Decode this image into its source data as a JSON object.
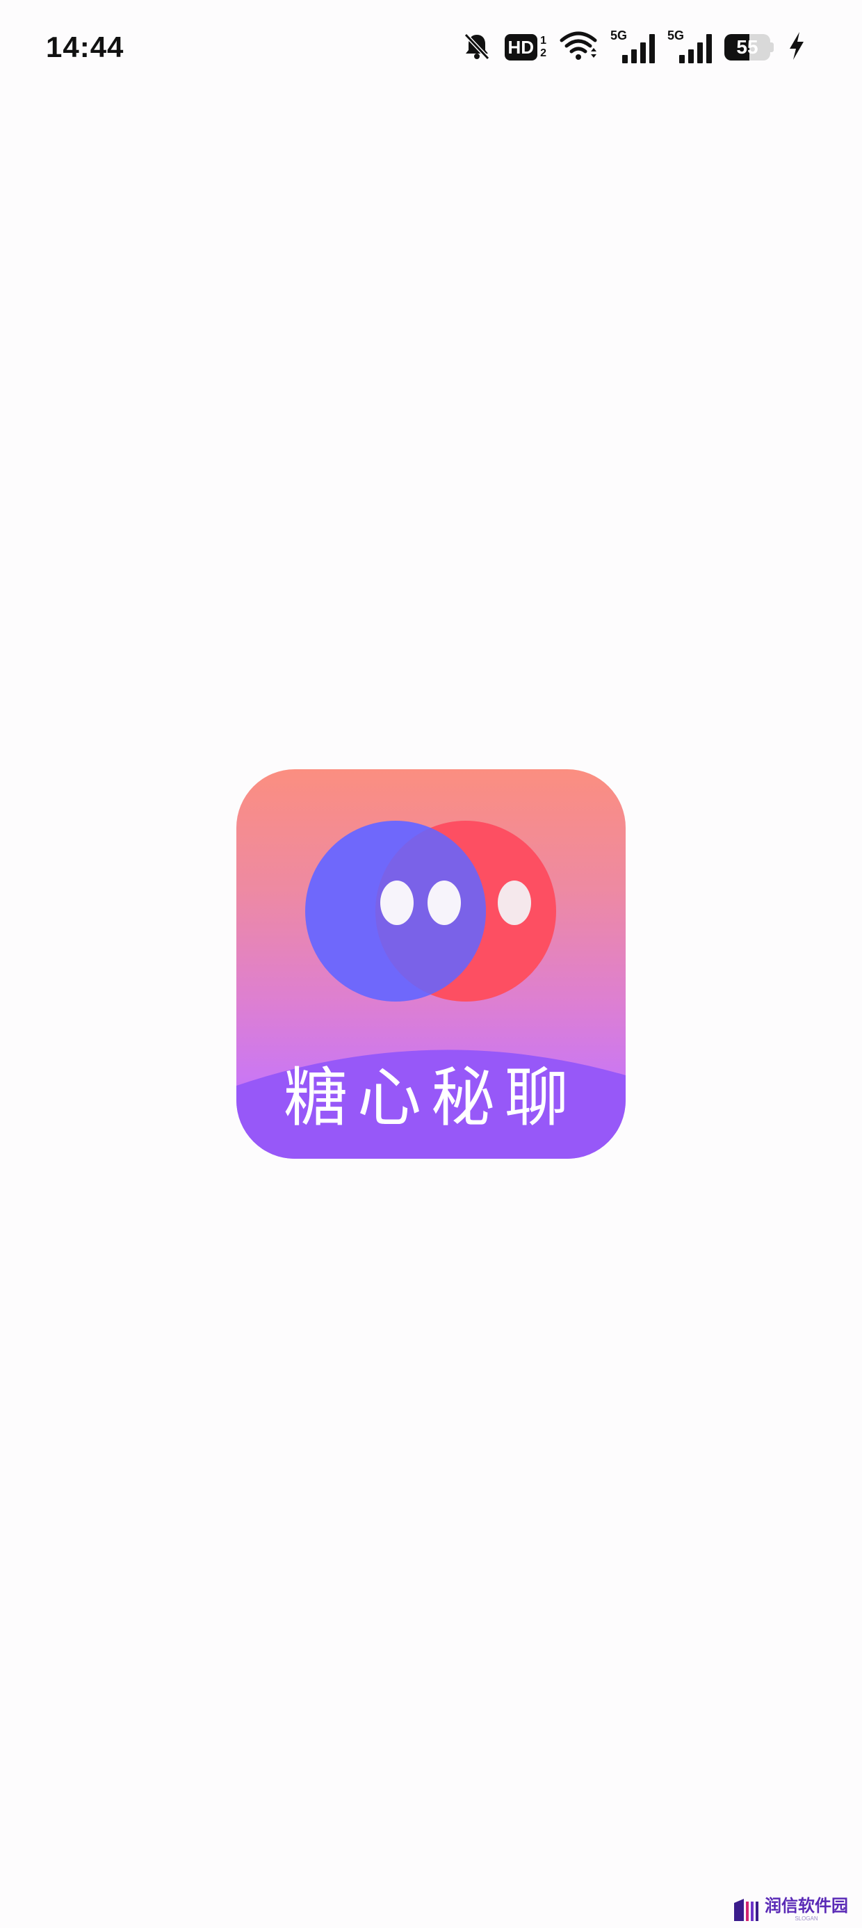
{
  "status_bar": {
    "time": "14:44",
    "hd_label": "HD",
    "hd_sub_top": "1",
    "hd_sub_bottom": "2",
    "sim1_label": "5G",
    "sim2_label": "5G",
    "battery_level": "55",
    "icons": [
      "bell-muted-icon",
      "hd-icon",
      "wifi-icon",
      "signal-5g-icon",
      "signal-5g-icon",
      "battery-icon",
      "charging-bolt-icon"
    ]
  },
  "app": {
    "name": "糖心秘聊"
  },
  "watermark": {
    "text": "润信软件园",
    "slogan": "SLOGAN"
  },
  "colors": {
    "logo_gradient_top": "#fb8e80",
    "logo_gradient_bottom": "#a25ff7",
    "logo_band": "#9758f8",
    "blue_circle": "#6f68fb",
    "red_circle": "#fd4f62",
    "watermark": "#5a2ab6"
  }
}
